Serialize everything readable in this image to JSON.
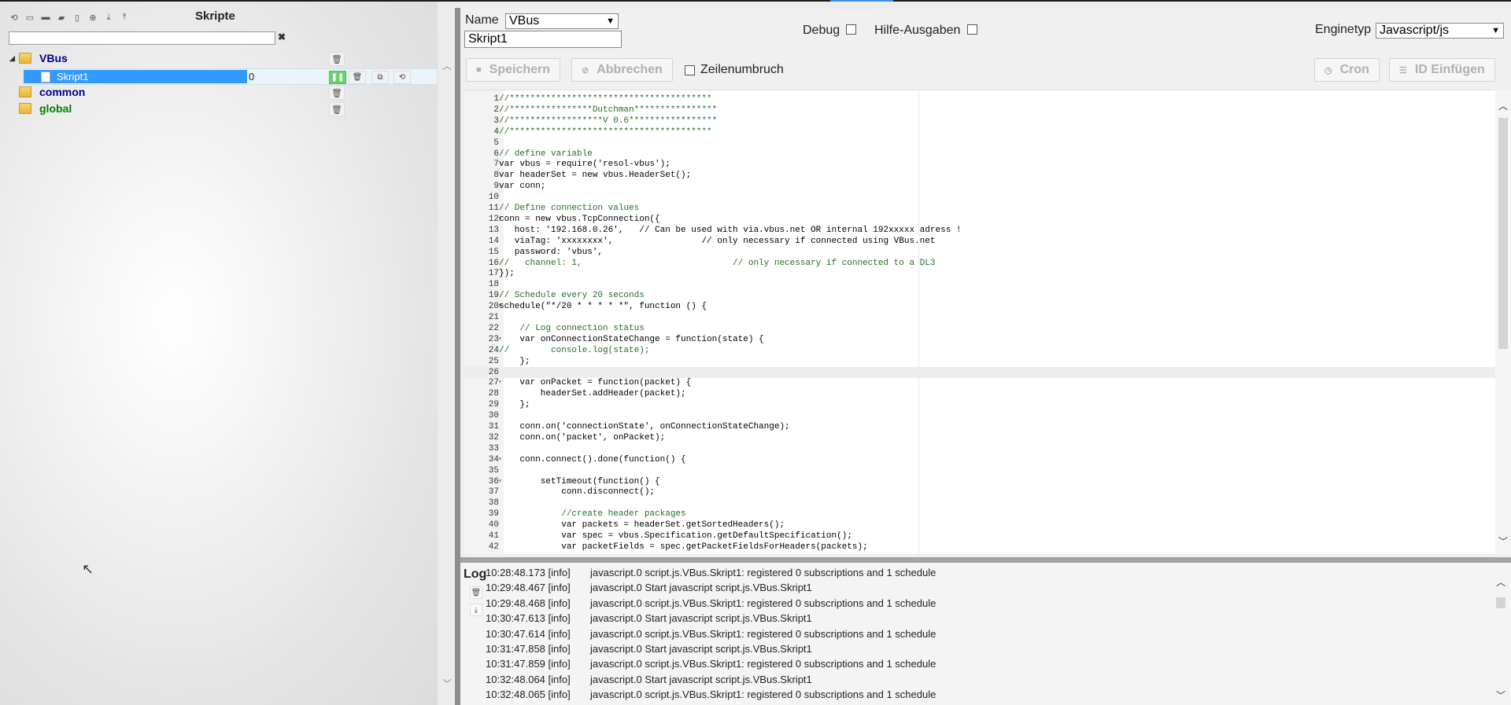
{
  "left_panel": {
    "title": "Skripte",
    "toolbar_icons": [
      "refresh-icon",
      "collapse-icon",
      "folder-icon",
      "folder-open-icon",
      "file-icon",
      "add-icon",
      "download-icon",
      "upload-icon"
    ],
    "filter_value": "",
    "clear_symbol": "✖",
    "tree": [
      {
        "label": "VBus",
        "color": "#00008b",
        "expanded": true
      },
      {
        "label": "common",
        "color": "#00008b"
      },
      {
        "label": "global",
        "color": "#008000"
      }
    ],
    "selected_script": {
      "label": "Skript1",
      "value": "0"
    }
  },
  "form": {
    "name_label": "Name",
    "name_value": "VBus",
    "script_name": "Skript1",
    "debug_label": "Debug",
    "hilfe_label": "Hilfe-Ausgaben",
    "engine_label": "Enginetyp",
    "engine_value": "Javascript/js"
  },
  "toolbar": {
    "save_label": "Speichern",
    "cancel_label": "Abbrechen",
    "wrap_label": "Zeilenumbruch",
    "cron_label": "Cron",
    "id_label": "ID Einfügen"
  },
  "code_lines": [
    "//***************************************",
    "//****************Dutchman****************",
    "//******************V 0.6*****************",
    "//***************************************",
    "",
    "// define variable",
    "var vbus = require('resol-vbus');",
    "var headerSet = new vbus.HeaderSet();",
    "var conn;",
    "",
    "// Define connection values",
    "conn = new vbus.TcpConnection({",
    "   host: '192.168.0.26',   // Can be used with via.vbus.net OR internal 192xxxxx adress !",
    "   viaTag: 'xxxxxxxx',                 // only necessary if connected using VBus.net",
    "   password: 'vbus',",
    "//   channel: 1,                             // only necessary if connected to a DL3",
    "});",
    "",
    "// Schedule every 20 seconds",
    "schedule(\"*/20 * * * * *\", function () {",
    "",
    "    // Log connection status",
    "    var onConnectionStateChange = function(state) {",
    "//        console.log(state);",
    "    };",
    "",
    "    var onPacket = function(packet) {",
    "        headerSet.addHeader(packet);",
    "    };",
    "",
    "    conn.on('connectionState', onConnectionStateChange);",
    "    conn.on('packet', onPacket);",
    "",
    "    conn.connect().done(function() {",
    "",
    "        setTimeout(function() {",
    "            conn.disconnect();",
    "",
    "            //create header packages",
    "            var packets = headerSet.getSortedHeaders();",
    "            var spec = vbus.Specification.getDefaultSpecification();",
    "            var packetFields = spec.getPacketFieldsForHeaders(packets);"
  ],
  "fold_lines": [
    12,
    20,
    23,
    27,
    34,
    36
  ],
  "active_line": 26,
  "log": {
    "title": "Log",
    "entries": [
      {
        "time": "10:28:48.173 [info]",
        "msg": "javascript.0 script.js.VBus.Skript1: registered 0 subscriptions and 1 schedule"
      },
      {
        "time": "10:29:48.467 [info]",
        "msg": "javascript.0 Start javascript script.js.VBus.Skript1"
      },
      {
        "time": "10:29:48.468 [info]",
        "msg": "javascript.0 script.js.VBus.Skript1: registered 0 subscriptions and 1 schedule"
      },
      {
        "time": "10:30:47.613 [info]",
        "msg": "javascript.0 Start javascript script.js.VBus.Skript1"
      },
      {
        "time": "10:30:47.614 [info]",
        "msg": "javascript.0 script.js.VBus.Skript1: registered 0 subscriptions and 1 schedule"
      },
      {
        "time": "10:31:47.858 [info]",
        "msg": "javascript.0 Start javascript script.js.VBus.Skript1"
      },
      {
        "time": "10:31:47.859 [info]",
        "msg": "javascript.0 script.js.VBus.Skript1: registered 0 subscriptions and 1 schedule"
      },
      {
        "time": "10:32:48.064 [info]",
        "msg": "javascript.0 Start javascript script.js.VBus.Skript1"
      },
      {
        "time": "10:32:48.065 [info]",
        "msg": "javascript.0 script.js.VBus.Skript1: registered 0 subscriptions and 1 schedule"
      }
    ]
  },
  "colors": {
    "selection": "#3399ff",
    "comment": "#236e24",
    "running": "#6ad06a"
  }
}
